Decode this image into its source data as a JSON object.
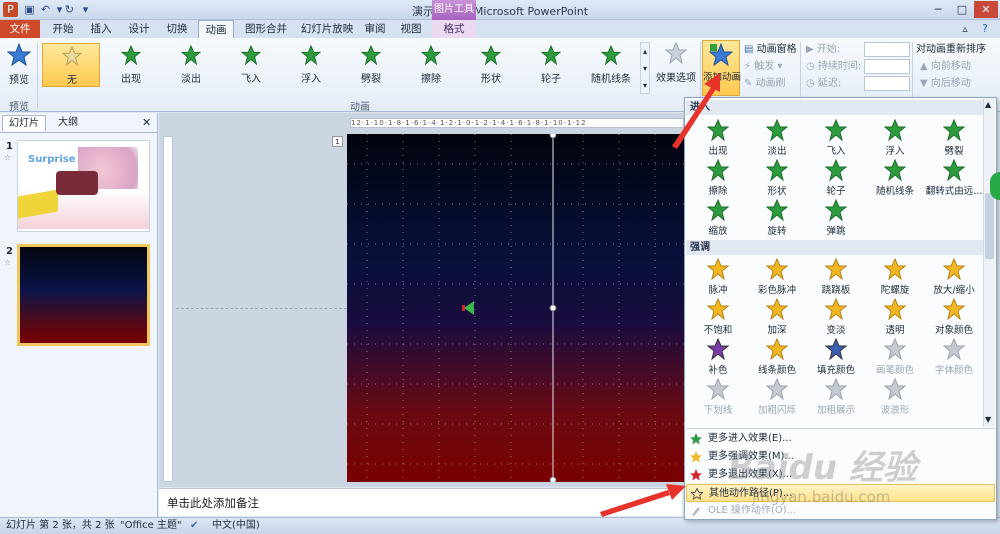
{
  "window": {
    "title": "演示文稿1 - Microsoft PowerPoint",
    "context_group": "图片工具"
  },
  "tabs": [
    {
      "label": "文件"
    },
    {
      "label": "开始"
    },
    {
      "label": "插入"
    },
    {
      "label": "设计"
    },
    {
      "label": "切换"
    },
    {
      "label": "动画"
    },
    {
      "label": "图形合并"
    },
    {
      "label": "幻灯片放映"
    },
    {
      "label": "审阅"
    },
    {
      "label": "视图"
    },
    {
      "label": "格式"
    }
  ],
  "ribbon": {
    "preview_label": "预览",
    "preview_group": "预览",
    "animation_group": "动画",
    "gallery": [
      {
        "label": "无"
      },
      {
        "label": "出现"
      },
      {
        "label": "淡出"
      },
      {
        "label": "飞入"
      },
      {
        "label": "浮入"
      },
      {
        "label": "劈裂"
      },
      {
        "label": "擦除"
      },
      {
        "label": "形状"
      },
      {
        "label": "轮子"
      },
      {
        "label": "随机线条"
      }
    ],
    "effect_options": "效果选项",
    "add_animation": "添加动画",
    "animation_pane": "动画窗格",
    "trigger": "触发",
    "animation_painter": "动画刷",
    "start_label": "开始:",
    "duration_label": "持续时间:",
    "delay_label": "延迟:",
    "reorder_title": "对动画重新排序",
    "move_earlier": "向前移动",
    "move_later": "向后移动"
  },
  "panel": {
    "tab_slides": "幻灯片",
    "tab_outline": "大纲",
    "slide1_num": "1",
    "slide2_num": "2",
    "slide1_text": "Surprise"
  },
  "ruler": {
    "marks": "12·1·10·1·8·1·6·1·4·1·2·1·0·1·2·1·4·1·6·1·8·1·10·1·12"
  },
  "notes_placeholder": "单击此处添加备注",
  "status": {
    "slide_info": "幻灯片 第 2 张，共 2 张",
    "theme": "\"Office 主题\"",
    "language": "中文(中国)"
  },
  "dropdown": {
    "section_entrance": "进入",
    "section_emphasis": "强调",
    "entrance": [
      {
        "label": "出现"
      },
      {
        "label": "淡出"
      },
      {
        "label": "飞入"
      },
      {
        "label": "浮入"
      },
      {
        "label": "劈裂"
      },
      {
        "label": "擦除"
      },
      {
        "label": "形状"
      },
      {
        "label": "轮子"
      },
      {
        "label": "随机线条"
      },
      {
        "label": "翻转式由远..."
      },
      {
        "label": "缩放"
      },
      {
        "label": "旋转"
      },
      {
        "label": "弹跳"
      }
    ],
    "emphasis": [
      {
        "label": "脉冲"
      },
      {
        "label": "彩色脉冲"
      },
      {
        "label": "跷跷板"
      },
      {
        "label": "陀螺旋"
      },
      {
        "label": "放大/缩小"
      },
      {
        "label": "不饱和"
      },
      {
        "label": "加深"
      },
      {
        "label": "变淡"
      },
      {
        "label": "透明"
      },
      {
        "label": "对象颜色"
      },
      {
        "label": "补色"
      },
      {
        "label": "线条颜色"
      },
      {
        "label": "填充颜色"
      },
      {
        "label": "画笔颜色"
      },
      {
        "label": "字体颜色"
      },
      {
        "label": "下划线"
      },
      {
        "label": "加粗闪烁"
      },
      {
        "label": "加粗展示"
      },
      {
        "label": "波浪形"
      }
    ],
    "menu": [
      {
        "label": "更多进入效果(E)..."
      },
      {
        "label": "更多强调效果(M)..."
      },
      {
        "label": "更多退出效果(X)..."
      },
      {
        "label": "其他动作路径(P)..."
      },
      {
        "label": "OLE 操作动作(O)..."
      }
    ]
  },
  "watermark": {
    "brand": "Baidu 经验",
    "url": "jingyan.baidu.com"
  },
  "colors": {
    "accent_file_tab": "#cf4a2a",
    "highlight": "#ffc94f",
    "arrow": "#e8332a"
  }
}
